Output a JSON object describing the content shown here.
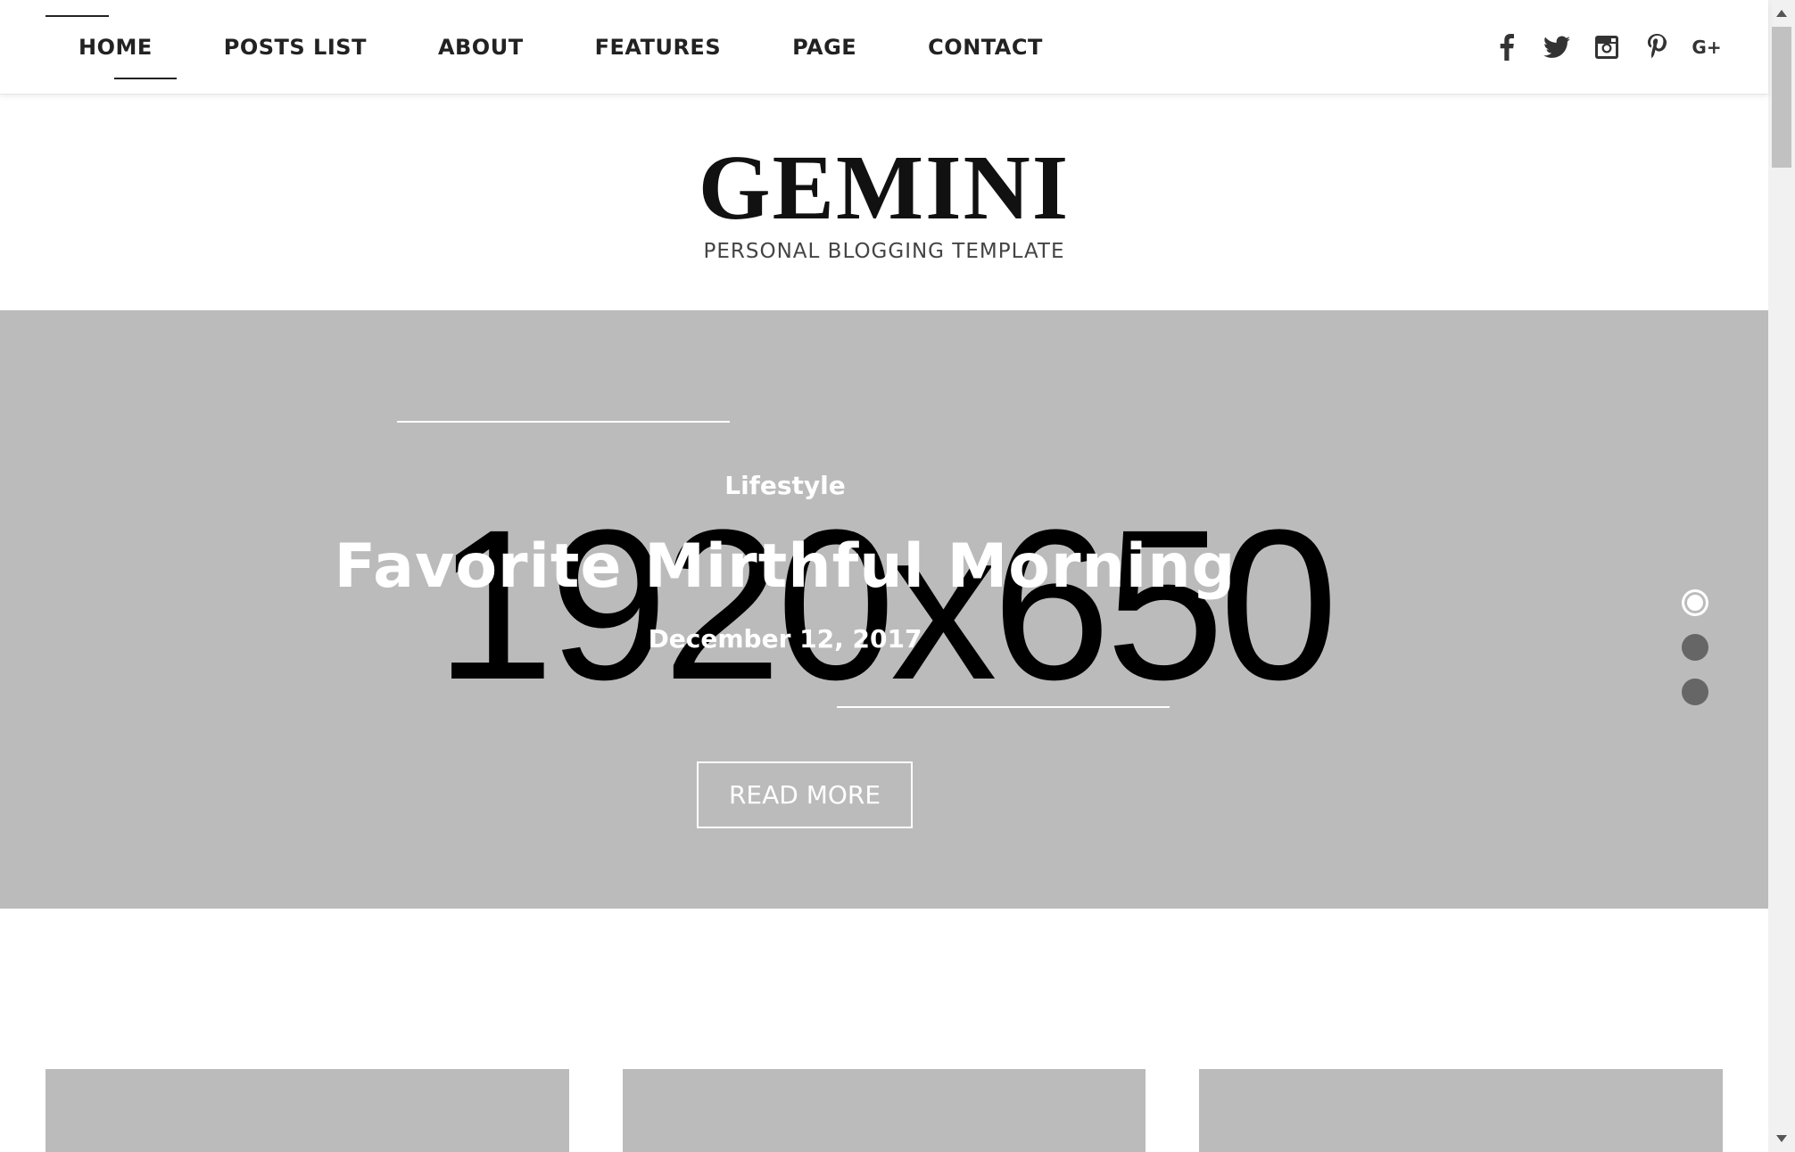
{
  "nav": {
    "items": [
      {
        "label": "HOME",
        "active": true
      },
      {
        "label": "POSTS LIST",
        "active": false
      },
      {
        "label": "ABOUT",
        "active": false
      },
      {
        "label": "FEATURES",
        "active": false
      },
      {
        "label": "PAGE",
        "active": false
      },
      {
        "label": "CONTACT",
        "active": false
      }
    ],
    "social": [
      "facebook-icon",
      "twitter-icon",
      "instagram-icon",
      "pinterest-icon",
      "google-plus-icon"
    ],
    "google_plus_text": "G+"
  },
  "logo": {
    "name": "GEMINI",
    "tagline": "PERSONAL BLOGGING TEMPLATE"
  },
  "hero": {
    "placeholder": "1920x650",
    "category": "Lifestyle",
    "title": "Favorite Mirthful Morning",
    "date": "December 12, 2017",
    "button": "READ MORE",
    "slides": 3,
    "active_slide": 1,
    "background": "#bbbbbb"
  },
  "cards": {
    "count": 3,
    "background": "#bbbbbb"
  },
  "colors": {
    "text": "#222222",
    "accent": "#ffffff",
    "hero_bg": "#bbbbbb"
  }
}
